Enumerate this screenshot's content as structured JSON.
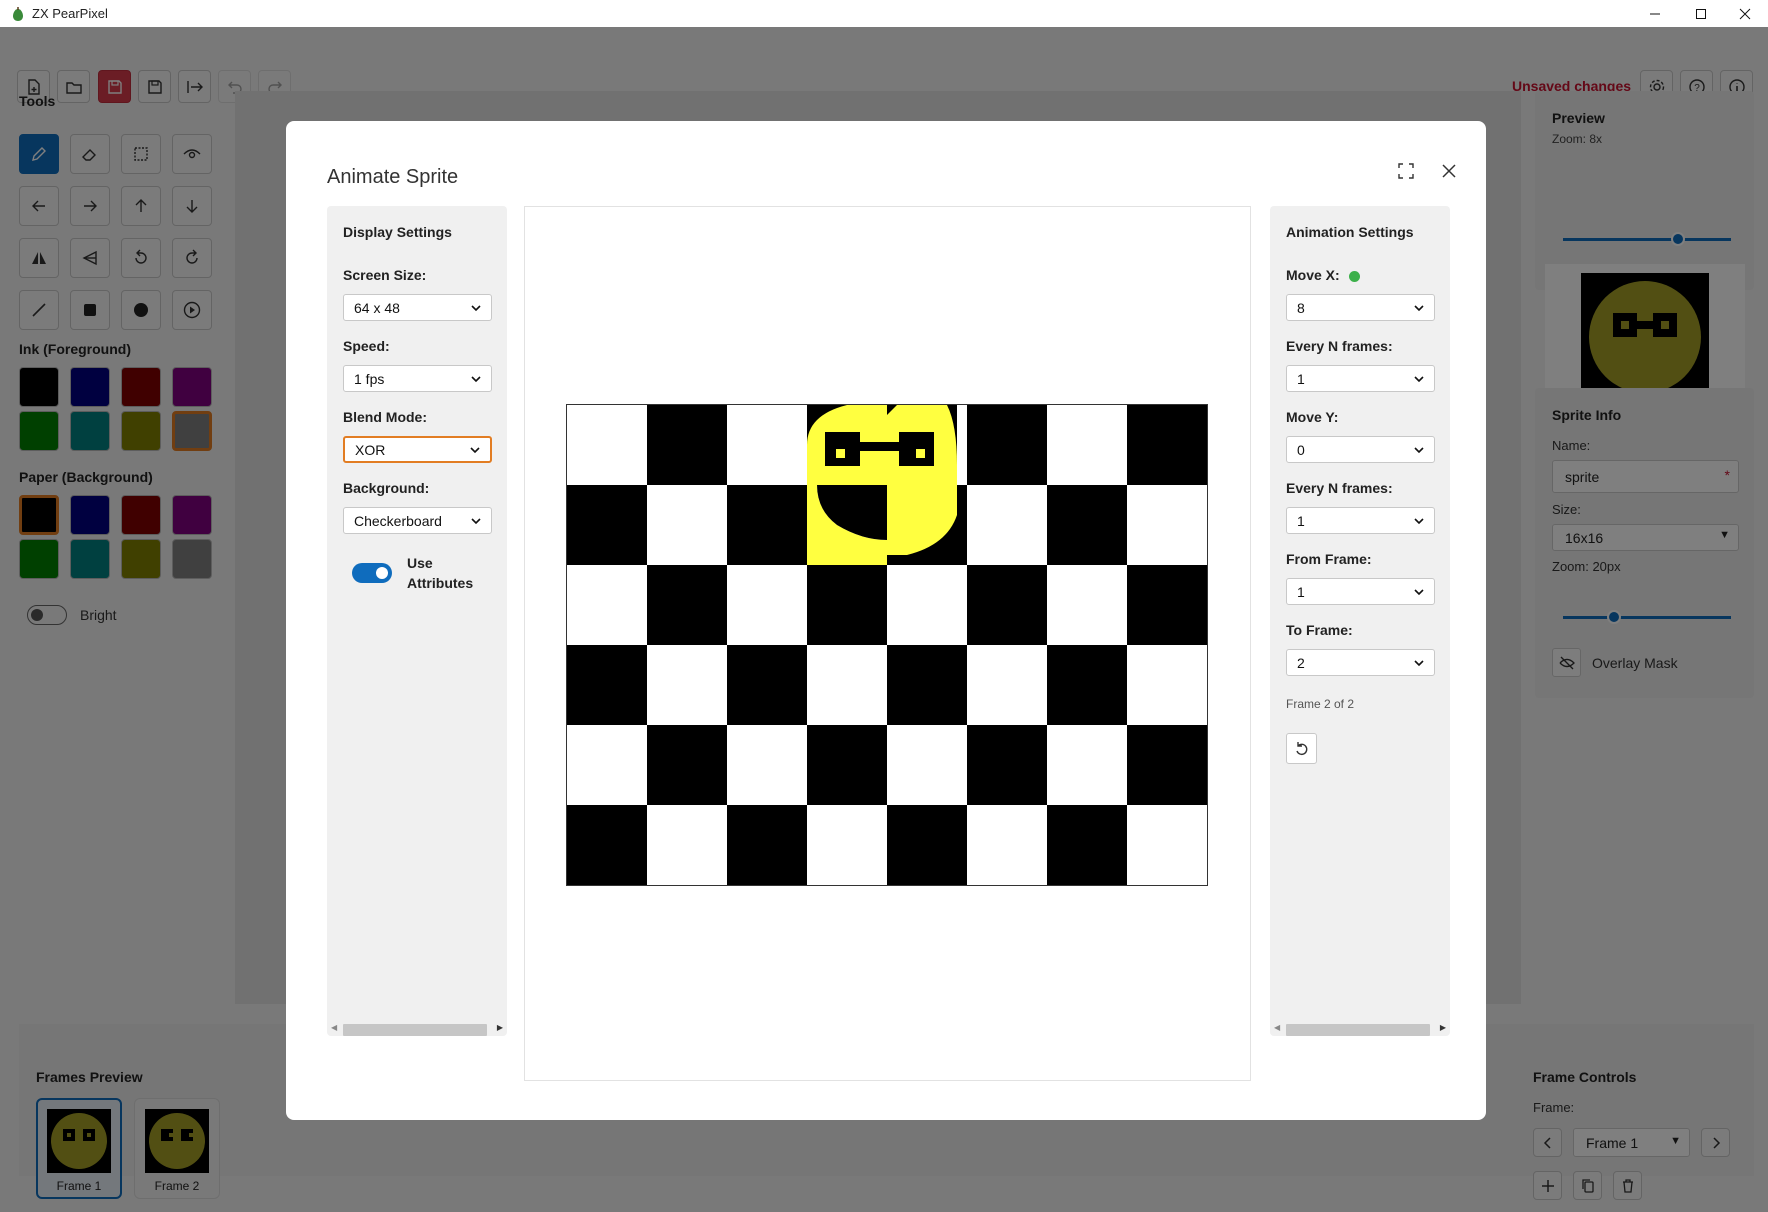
{
  "window": {
    "title": "ZX PearPixel"
  },
  "toolbar": {
    "status": "Unsaved changes"
  },
  "tools": {
    "label": "Tools"
  },
  "ink": {
    "label": "Ink (Foreground)",
    "colors": [
      "#000000",
      "#000080",
      "#800000",
      "#800080",
      "#008000",
      "#008080",
      "#808000",
      "#808080"
    ],
    "selected": 7
  },
  "paper": {
    "label": "Paper (Background)",
    "colors": [
      "#000000",
      "#000080",
      "#800000",
      "#800080",
      "#008000",
      "#008080",
      "#808000",
      "#808080"
    ],
    "selected": 0
  },
  "bright": {
    "label": "Bright",
    "on": false
  },
  "preview": {
    "title": "Preview",
    "zoom_label": "Zoom: 8x"
  },
  "sprite_info": {
    "title": "Sprite Info",
    "name_label": "Name:",
    "name_value": "sprite",
    "required_mark": "*",
    "size_label": "Size:",
    "size_value": "16x16",
    "zoom_label": "Zoom: 20px",
    "overlay_label": "Overlay Mask"
  },
  "frames_preview": {
    "title": "Frames Preview",
    "frames": [
      "Frame 1",
      "Frame 2"
    ],
    "selected": 0
  },
  "frame_controls": {
    "title": "Frame Controls",
    "frame_label": "Frame:",
    "frame_value": "Frame 1"
  },
  "modal": {
    "title": "Animate Sprite",
    "display": {
      "title": "Display Settings",
      "screen_size_label": "Screen Size:",
      "screen_size_value": "64 x 48",
      "speed_label": "Speed:",
      "speed_value": "1 fps",
      "blend_label": "Blend Mode:",
      "blend_value": "XOR",
      "background_label": "Background:",
      "background_value": "Checkerboard",
      "use_attr_label": "Use Attributes",
      "use_attr_on": true
    },
    "animation": {
      "title": "Animation Settings",
      "move_x_label": "Move X:",
      "move_x_value": "8",
      "move_x_status_color": "#3cb04a",
      "every_n1_label": "Every N frames:",
      "every_n1_value": "1",
      "move_y_label": "Move Y:",
      "move_y_value": "0",
      "every_n2_label": "Every N frames:",
      "every_n2_value": "1",
      "from_label": "From Frame:",
      "from_value": "1",
      "to_label": "To Frame:",
      "to_value": "2",
      "frame_status": "Frame 2 of 2"
    }
  },
  "colors": {
    "accent": "#0f6cbd",
    "danger": "#c8102e",
    "sprite_yellow": "#ffff40"
  }
}
